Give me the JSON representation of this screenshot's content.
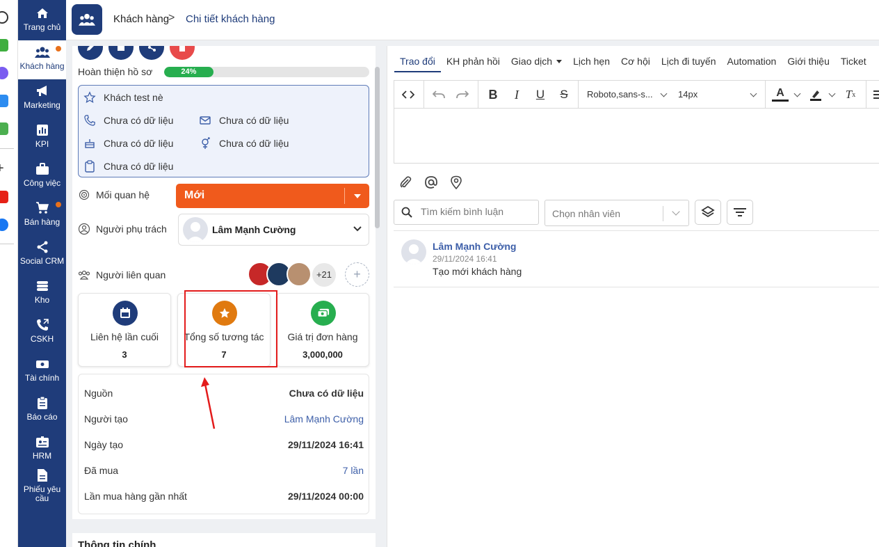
{
  "sidebar": {
    "items": [
      {
        "label": "Trang chủ",
        "icon": "home-icon"
      },
      {
        "label": "Khách hàng",
        "icon": "users-icon"
      },
      {
        "label": "Marketing",
        "icon": "megaphone-icon"
      },
      {
        "label": "KPI",
        "icon": "chart-icon"
      },
      {
        "label": "Công việc",
        "icon": "briefcase-icon"
      },
      {
        "label": "Bán hàng",
        "icon": "cart-icon"
      },
      {
        "label": "Social CRM",
        "icon": "share-icon"
      },
      {
        "label": "Kho",
        "icon": "warehouse-icon"
      },
      {
        "label": "CSKH",
        "icon": "phone-icon"
      },
      {
        "label": "Tài chính",
        "icon": "money-icon"
      },
      {
        "label": "Báo cáo",
        "icon": "clipboard-icon"
      },
      {
        "label": "HRM",
        "icon": "id-card-icon"
      },
      {
        "label": "Phiếu yêu cầu",
        "icon": "document-icon"
      }
    ]
  },
  "header": {
    "crumb_parent": "Khách hàng",
    "crumb_separator": ">",
    "crumb_current": "Chi tiết khách hàng"
  },
  "customer": {
    "progress_label": "Hoàn thiện hồ sơ",
    "progress_value": "24%",
    "progress_fraction": 0.24,
    "name": "Khách test nè",
    "phone": "Chưa có dữ liệu",
    "email": "Chưa có dữ liệu",
    "birthday": "Chưa có dữ liệu",
    "gender": "Chưa có dữ liệu",
    "note": "Chưa có dữ liệu",
    "relationship_label": "Mối quan hệ",
    "relationship_value": "Mới",
    "owner_label": "Người phụ trách",
    "owner_value": "Lâm Mạnh Cường",
    "related_label": "Người liên quan",
    "related_more": "+21",
    "add_related": "+"
  },
  "stats": [
    {
      "label": "Liên hệ lần cuối",
      "value": "3",
      "color": "#1f3c7a",
      "icon": "calendar-icon"
    },
    {
      "label": "Tổng số tương tác",
      "value": "7",
      "color": "#e07a10",
      "icon": "star-icon"
    },
    {
      "label": "Giá trị đơn hàng",
      "value": "3,000,000",
      "color": "#27ae4f",
      "icon": "money-icon"
    }
  ],
  "details": [
    {
      "key": "Nguồn",
      "value": "Chưa có dữ liệu"
    },
    {
      "key": "Người tạo",
      "value": "Lâm Mạnh Cường"
    },
    {
      "key": "Ngày tạo",
      "value": "29/11/2024 16:41"
    },
    {
      "key": "Đã mua",
      "value": "7 lần"
    },
    {
      "key": "Lần mua hàng gần nhất",
      "value": "29/11/2024 00:00"
    }
  ],
  "main_info_title": "Thông tin chính",
  "tabs": [
    {
      "label": "Trao đổi"
    },
    {
      "label": "KH phản hồi"
    },
    {
      "label": "Giao dịch"
    },
    {
      "label": "Lịch hẹn"
    },
    {
      "label": "Cơ hội"
    },
    {
      "label": "Lịch đi tuyến"
    },
    {
      "label": "Automation"
    },
    {
      "label": "Giới thiệu"
    },
    {
      "label": "Ticket"
    }
  ],
  "editor": {
    "font": "Roboto,sans-s...",
    "size": "14px"
  },
  "filters": {
    "search_placeholder": "Tìm kiếm bình luận",
    "employee_placeholder": "Chọn nhân viên"
  },
  "comment": {
    "author": "Lâm Mạnh Cường",
    "time": "29/11/2024 16:41",
    "text": "Tạo mới khách hàng"
  },
  "colors": {
    "sidebar": "#1f3c7a",
    "status": "#f05a1c",
    "highlight": "#e31b1b"
  }
}
